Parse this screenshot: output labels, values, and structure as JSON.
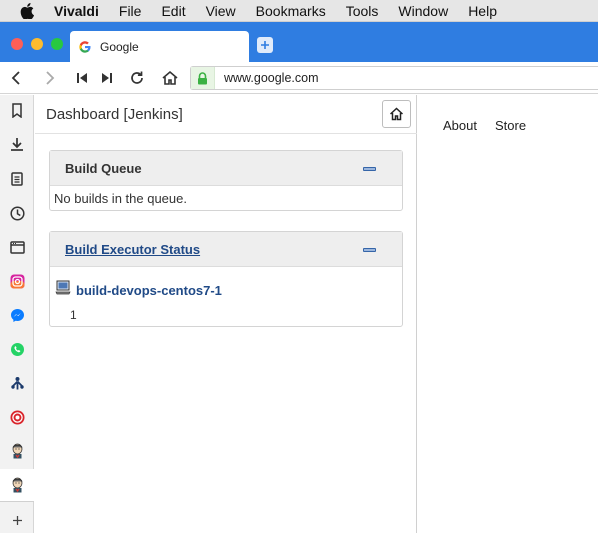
{
  "menubar": {
    "app": "Vivaldi",
    "items": [
      "File",
      "Edit",
      "View",
      "Bookmarks",
      "Tools",
      "Window",
      "Help"
    ]
  },
  "tab": {
    "title": "Google"
  },
  "address": {
    "url": "www.google.com"
  },
  "panel": {
    "title": "Dashboard [Jenkins]",
    "build_queue": {
      "title": "Build Queue",
      "message": "No builds in the queue."
    },
    "executors": {
      "title": "Build Executor Status",
      "node": "build-devops-centos7-1",
      "executor_number": "1"
    }
  },
  "page": {
    "links": [
      "About",
      "Store"
    ]
  },
  "colors": {
    "accent": "#2f7de1",
    "link": "#204a87",
    "secure": "#3bb143"
  }
}
